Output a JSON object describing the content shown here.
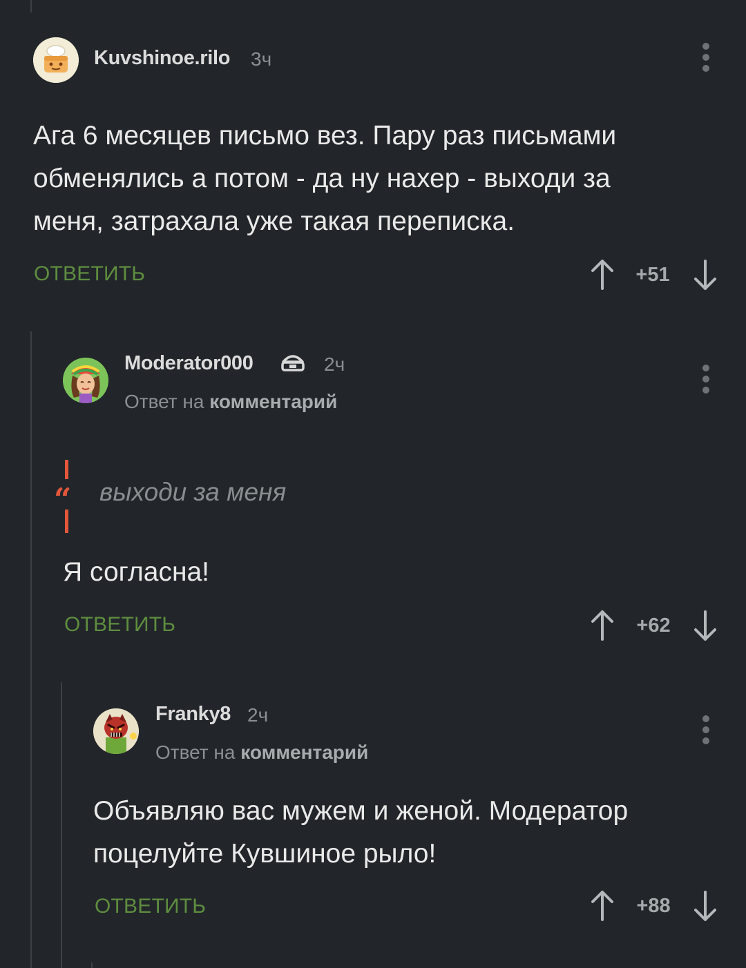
{
  "comments": [
    {
      "author": "Kuvshinoe.rilo",
      "time": "3ч",
      "text": "Ага 6 месяцев письмо вез. Пару раз письмами\nобменялись а потом - да ну нахер - выходи за\nменя, затрахала уже такая переписка.",
      "reply_label": "ОТВЕТИТЬ",
      "score": "+51",
      "avatar_icon": "chef-cake-icon"
    },
    {
      "author": "Moderator000",
      "author_badge": "moderator-badge-icon",
      "time": "2ч",
      "reply_prefix": "Ответ на",
      "reply_link": "комментарий",
      "quote": "выходи за меня",
      "text": "Я согласна!",
      "reply_label": "ОТВЕТИТЬ",
      "score": "+62",
      "avatar_icon": "girl-rasta-hat-icon"
    },
    {
      "author": "Franky8",
      "time": "2ч",
      "reply_prefix": "Ответ на",
      "reply_link": "комментарий",
      "text": "Объявляю вас мужем и женой. Модератор\nпоцелуйте Кувшиное рыло!",
      "reply_label": "ОТВЕТИТЬ",
      "score": "+88",
      "avatar_icon": "red-monster-icon"
    }
  ],
  "colors": {
    "background": "#22262a",
    "reply_green": "#5e8d3f",
    "quote_accent": "#e4573d",
    "muted_text": "#8b8f93"
  }
}
